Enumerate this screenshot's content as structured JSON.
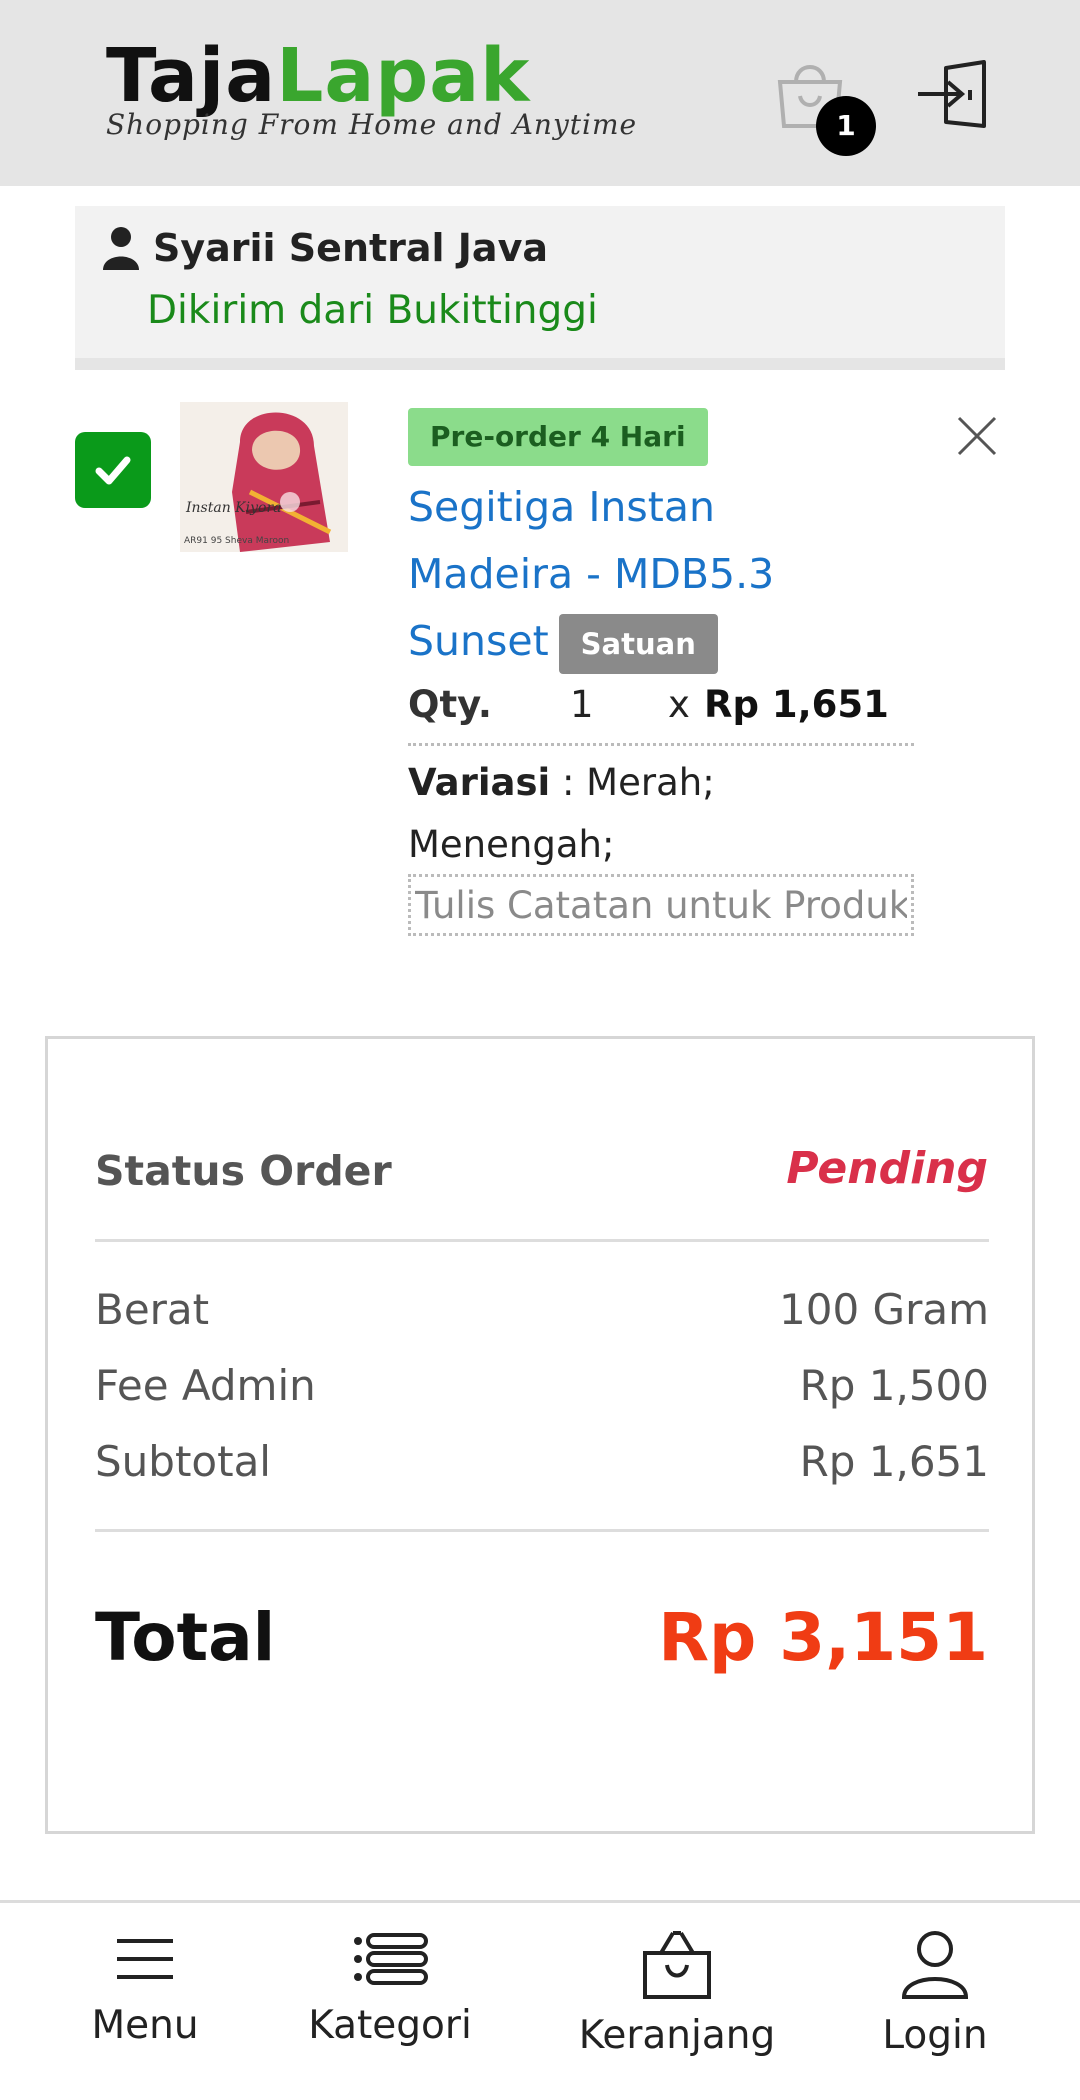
{
  "header": {
    "logo_part1": "Taja",
    "logo_part2": "Lapak",
    "tagline": "Shopping From Home and Anytime",
    "cart_count": "1"
  },
  "seller": {
    "name": "Syarii Sentral Java",
    "ship_from": "Dikirim dari Bukittinggi"
  },
  "product": {
    "checked": true,
    "image_text": "Instan Kiyora",
    "image_code": "AR91 95 Sheva Maroon",
    "badge": "Pre-order 4 Hari",
    "title": "Segitiga Instan Madeira - MDB5.3 Sunset",
    "unit_badge": "Satuan",
    "qty_label": "Qty.",
    "qty_value": "1",
    "qty_times": "x",
    "price": "Rp 1,651",
    "variasi_label": "Variasi",
    "variasi_value": ": Merah; Menengah;",
    "note_placeholder": "Tulis Catatan untuk Produk"
  },
  "summary": {
    "status_label": "Status Order",
    "status_value": "Pending",
    "rows": [
      {
        "label": "Berat",
        "value": "100 Gram"
      },
      {
        "label": "Fee Admin",
        "value": "Rp 1,500"
      },
      {
        "label": "Subtotal",
        "value": "Rp 1,651"
      }
    ],
    "total_label": "Total",
    "total_value": "Rp 3,151"
  },
  "bottom_nav": [
    {
      "label": "Menu",
      "icon": "menu-icon"
    },
    {
      "label": "Kategori",
      "icon": "list-icon"
    },
    {
      "label": "Keranjang",
      "icon": "bag-icon"
    },
    {
      "label": "Login",
      "icon": "user-icon"
    }
  ],
  "colors": {
    "brand_green": "#3aa62e",
    "link_blue": "#1a73c8",
    "pending_red": "#d9304a",
    "total_orange": "#f03c14"
  }
}
